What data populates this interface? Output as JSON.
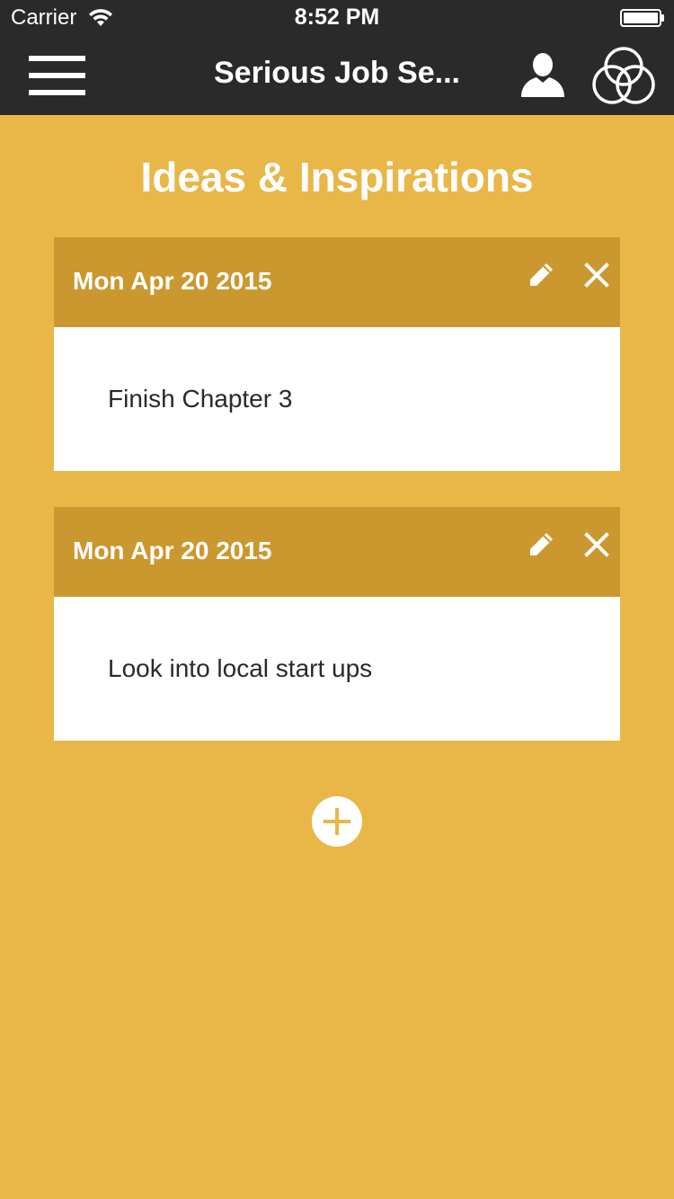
{
  "status_bar": {
    "carrier": "Carrier",
    "time": "8:52 PM",
    "wifi_icon": "wifi-icon",
    "battery_icon": "battery-icon"
  },
  "nav_bar": {
    "title": "Serious Job Se...",
    "menu_icon": "hamburger-menu-icon",
    "user_icon": "user-icon",
    "circles_icon": "interlocking-circles-icon"
  },
  "page": {
    "title": "Ideas & Inspirations"
  },
  "notes": [
    {
      "date": "Mon Apr 20 2015",
      "text": "Finish Chapter 3",
      "edit_icon": "pencil-icon",
      "delete_icon": "close-icon"
    },
    {
      "date": "Mon Apr 20 2015",
      "text": "Look into local start ups",
      "edit_icon": "pencil-icon",
      "delete_icon": "close-icon"
    }
  ],
  "add_button": {
    "icon": "plus-circle-icon"
  },
  "colors": {
    "background": "#E8B748",
    "card_header": "#CA982E",
    "nav_bar": "#2A2A2A",
    "card_body": "#FFFFFF",
    "text_dark": "#2A2A2A"
  }
}
